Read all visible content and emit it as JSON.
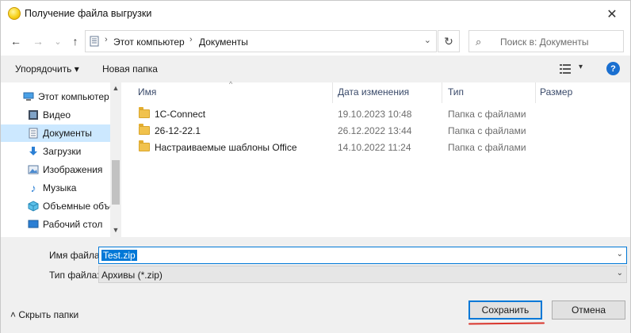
{
  "window": {
    "title": "Получение файла выгрузки",
    "close_glyph": "✕"
  },
  "nav": {
    "back_glyph": "←",
    "forward_glyph": "→",
    "recent_glyph": "⌄",
    "up_glyph": "↑",
    "address": [
      "Этот компьютер",
      "Документы"
    ],
    "refresh_glyph": "↻",
    "search_placeholder": "Поиск в: Документы"
  },
  "toolbar": {
    "organize_label": "Упорядочить ▾",
    "new_folder_label": "Новая папка",
    "help_label": "?"
  },
  "sidebar": {
    "items": [
      {
        "label": "Этот компьютер",
        "icon": "computer-icon"
      },
      {
        "label": "Видео",
        "icon": "video-icon"
      },
      {
        "label": "Документы",
        "icon": "documents-icon",
        "selected": true
      },
      {
        "label": "Загрузки",
        "icon": "downloads-icon"
      },
      {
        "label": "Изображения",
        "icon": "pictures-icon"
      },
      {
        "label": "Музыка",
        "icon": "music-icon"
      },
      {
        "label": "Объемные объекты",
        "icon": "3d-objects-icon"
      },
      {
        "label": "Рабочий стол",
        "icon": "desktop-icon"
      }
    ]
  },
  "files": {
    "columns": [
      "Имя",
      "Дата изменения",
      "Тип",
      "Размер"
    ],
    "rows": [
      {
        "name": "1C-Connect",
        "date": "19.10.2023 10:48",
        "type": "Папка с файлами",
        "size": ""
      },
      {
        "name": "26-12-22.1",
        "date": "26.12.2022 13:44",
        "type": "Папка с файлами",
        "size": ""
      },
      {
        "name": "Настраиваемые шаблоны Office",
        "date": "14.10.2022 11:24",
        "type": "Папка с файлами",
        "size": ""
      }
    ]
  },
  "form": {
    "filename_label": "Имя файла:",
    "filename_value": "Test.zip",
    "filetype_label": "Тип файла:",
    "filetype_value": "Архивы (*.zip)",
    "hide_folders_label": "˄  Скрыть папки",
    "save_label": "Сохранить",
    "cancel_label": "Отмена"
  },
  "colors": {
    "accent": "#0078d7",
    "selection": "#cce8ff",
    "folder": "#f1c24d",
    "annotation": "#d9342b"
  }
}
